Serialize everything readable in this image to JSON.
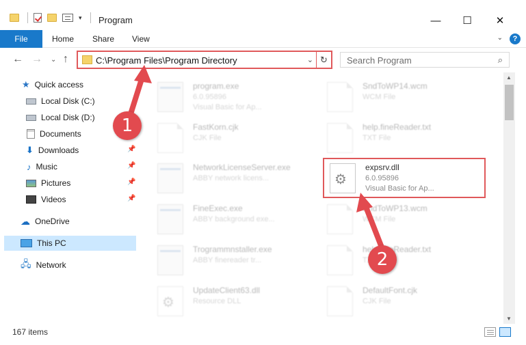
{
  "window": {
    "title": "Program",
    "minimize_glyph": "—",
    "maximize_glyph": "☐",
    "close_glyph": "✕"
  },
  "ribbon": {
    "file": "File",
    "home": "Home",
    "share": "Share",
    "view": "View",
    "help": "?"
  },
  "address": {
    "path": "C:\\Program Files\\Program Directory",
    "search_placeholder": "Search Program"
  },
  "sidebar": {
    "items": [
      {
        "label": "Quick access"
      },
      {
        "label": "Local Disk (C:)"
      },
      {
        "label": "Local Disk (D:)"
      },
      {
        "label": "Documents"
      },
      {
        "label": "Downloads"
      },
      {
        "label": "Music"
      },
      {
        "label": "Pictures"
      },
      {
        "label": "Videos"
      },
      {
        "label": "OneDrive"
      },
      {
        "label": "This PC"
      },
      {
        "label": "Network"
      }
    ]
  },
  "files": [
    {
      "name": "program.exe",
      "line1": "6.0.95896",
      "line2": "Visual Basic for Ap..."
    },
    {
      "name": "SndToWP14.wcm",
      "line1": "WCM File",
      "line2": ""
    },
    {
      "name": "FastKorn.cjk",
      "line1": "CJK File",
      "line2": ""
    },
    {
      "name": "help.fineReader.txt",
      "line1": "TXT File",
      "line2": ""
    },
    {
      "name": "NetworkLicenseServer.exe",
      "line1": "ABBY network licens...",
      "line2": ""
    },
    {
      "name": "expsrv.dll",
      "line1": "6.0.95896",
      "line2": "Visual Basic for Ap..."
    },
    {
      "name": "FineExec.exe",
      "line1": "ABBY background exe...",
      "line2": ""
    },
    {
      "name": "SndToWP13.wcm",
      "line1": "WCM File",
      "line2": ""
    },
    {
      "name": "Trogrammnstaller.exe",
      "line1": "ABBY finereader tr...",
      "line2": ""
    },
    {
      "name": "help.fineReader.txt",
      "line1": "TXT File",
      "line2": ""
    },
    {
      "name": "UpdateClient63.dll",
      "line1": "Resource DLL",
      "line2": ""
    },
    {
      "name": "DefaultFont.cjk",
      "line1": "CJK File",
      "line2": ""
    }
  ],
  "status": {
    "items_count": "167 items"
  },
  "callouts": {
    "one": "1",
    "two": "2"
  },
  "colors": {
    "accent": "#1979ca",
    "highlight_red": "#e0585a",
    "selection": "#cce8ff"
  }
}
